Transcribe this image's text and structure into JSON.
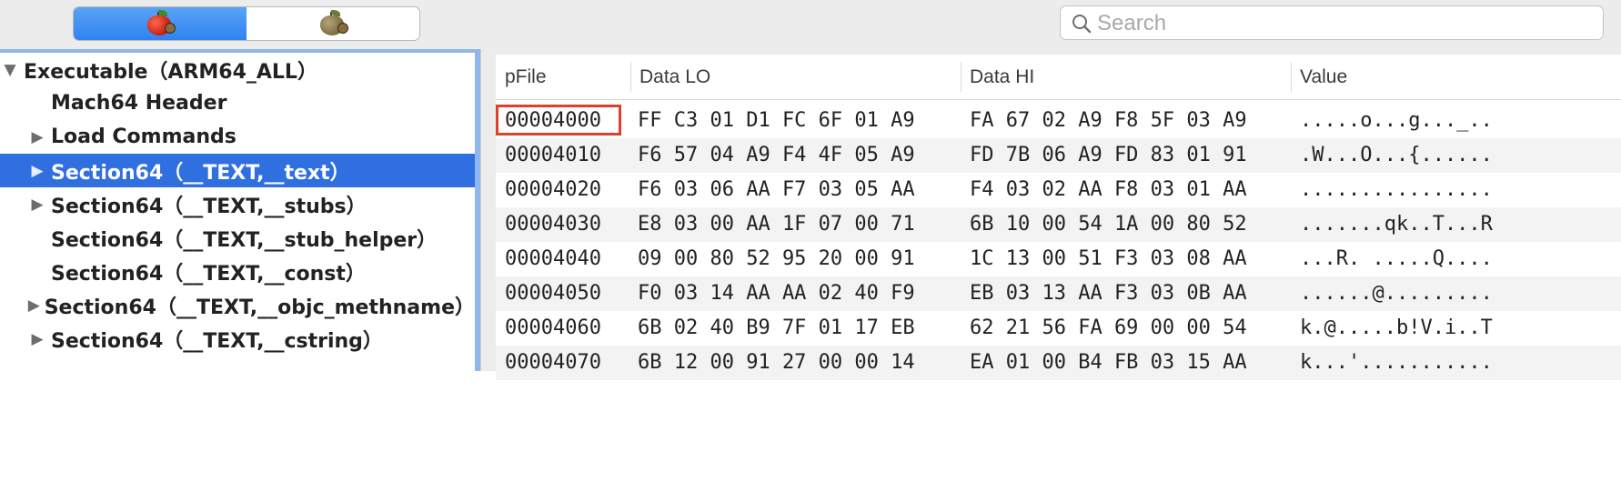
{
  "toolbar": {
    "view_buttons": [
      {
        "icon": "red-apple-icon",
        "active": true
      },
      {
        "icon": "gray-apple-icon",
        "active": false
      }
    ],
    "search": {
      "placeholder": "Search",
      "value": ""
    }
  },
  "tree": {
    "items": [
      {
        "label": "Executable（ARM64_ALL）",
        "expander": "expanded",
        "level": 0,
        "selected": false
      },
      {
        "label": "Mach64 Header",
        "expander": "none",
        "level": 1,
        "selected": false
      },
      {
        "label": "Load Commands",
        "expander": "collapsed",
        "level": 1,
        "selected": false
      },
      {
        "label": "Section64（__TEXT,__text）",
        "expander": "collapsed",
        "level": 1,
        "selected": true
      },
      {
        "label": "Section64（__TEXT,__stubs）",
        "expander": "collapsed",
        "level": 1,
        "selected": false
      },
      {
        "label": "Section64（__TEXT,__stub_helper）",
        "expander": "none",
        "level": 1,
        "selected": false
      },
      {
        "label": "Section64（__TEXT,__const）",
        "expander": "none",
        "level": 1,
        "selected": false
      },
      {
        "label": "Section64（__TEXT,__objc_methname）",
        "expander": "collapsed",
        "level": 1,
        "selected": false
      },
      {
        "label": "Section64（__TEXT,__cstring）",
        "expander": "collapsed",
        "level": 1,
        "selected": false
      }
    ]
  },
  "table": {
    "columns": [
      "pFile",
      "Data LO",
      "Data HI",
      "Value"
    ],
    "rows": [
      {
        "pfile": "00004000",
        "lo": "FF C3 01 D1 FC 6F 01 A9",
        "hi": "FA 67 02 A9 F8 5F 03 A9",
        "value": ".....o...g..._.."
      },
      {
        "pfile": "00004010",
        "lo": "F6 57 04 A9 F4 4F 05 A9",
        "hi": "FD 7B 06 A9 FD 83 01 91",
        "value": ".W...O...{......"
      },
      {
        "pfile": "00004020",
        "lo": "F6 03 06 AA F7 03 05 AA",
        "hi": "F4 03 02 AA F8 03 01 AA",
        "value": "................"
      },
      {
        "pfile": "00004030",
        "lo": "E8 03 00 AA 1F 07 00 71",
        "hi": "6B 10 00 54 1A 00 80 52",
        "value": ".......qk..T...R"
      },
      {
        "pfile": "00004040",
        "lo": "09 00 80 52 95 20 00 91",
        "hi": "1C 13 00 51 F3 03 08 AA",
        "value": "...R. .....Q...."
      },
      {
        "pfile": "00004050",
        "lo": "F0 03 14 AA AA 02 40 F9",
        "hi": "EB 03 13 AA F3 03 0B AA",
        "value": "......@........."
      },
      {
        "pfile": "00004060",
        "lo": "6B 02 40 B9 7F 01 17 EB",
        "hi": "62 21 56 FA 69 00 00 54",
        "value": "k.@.....b!V.i..T"
      },
      {
        "pfile": "00004070",
        "lo": "6B 12 00 91 27 00 00 14",
        "hi": "EA 01 00 B4 FB 03 15 AA",
        "value": "k...'..........."
      }
    ]
  },
  "colors": {
    "selection": "#2f6fdf",
    "highlight_box": "#e0402a",
    "active_segment": "#3d8bf2"
  }
}
